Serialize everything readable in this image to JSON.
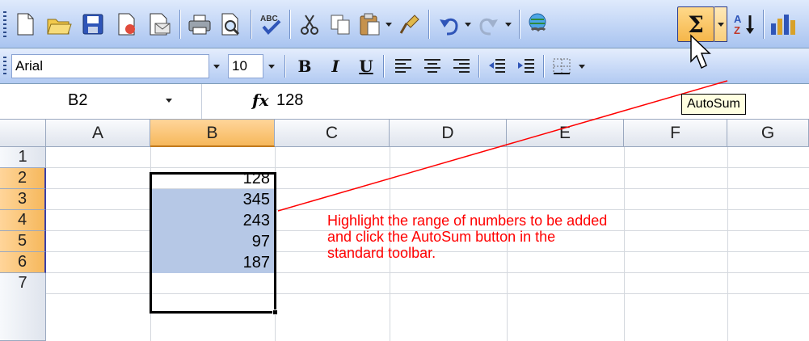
{
  "colors": {
    "accent": "#f5b64a",
    "annotation": "#ff0000",
    "selection_fill": "#b6c8e6"
  },
  "toolbar_standard": {
    "icons": [
      "new-icon",
      "open-icon",
      "save-icon",
      "permission-icon",
      "email-icon",
      "print-icon",
      "print-preview-icon",
      "spelling-icon",
      "cut-icon",
      "copy-icon",
      "paste-icon",
      "format-painter-icon",
      "undo-icon",
      "redo-icon",
      "hyperlink-icon",
      "autosum-icon",
      "sort-ascending-icon",
      "chart-wizard-icon"
    ],
    "autosum_symbol": "Σ"
  },
  "toolbar_formatting": {
    "font_name": "Arial",
    "font_size": "10",
    "bold": "B",
    "italic": "I",
    "underline": "U"
  },
  "formula_bar": {
    "name_box": "B2",
    "fx": "fx",
    "formula": "128"
  },
  "tooltip": "AutoSum",
  "grid": {
    "columns": [
      "A",
      "B",
      "C",
      "D",
      "E",
      "F",
      "G"
    ],
    "rows": [
      "1",
      "2",
      "3",
      "4",
      "5",
      "6",
      "7"
    ],
    "column_b_values": [
      "128",
      "345",
      "243",
      "97",
      "187"
    ]
  },
  "annotation": "Highlight the range of numbers to be added\nand click the AutoSum button in the\nstandard toolbar."
}
